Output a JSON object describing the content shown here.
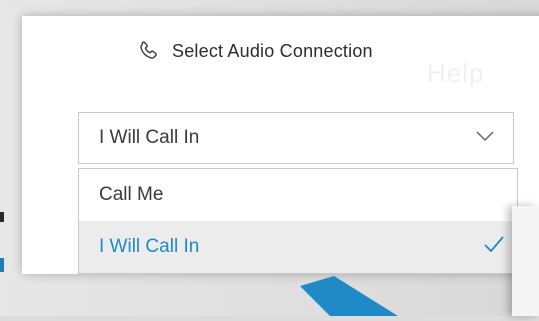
{
  "dialog": {
    "title": "Select Audio Connection",
    "faded_text": "Help"
  },
  "audio_select": {
    "selected_value": "I Will Call In",
    "options": [
      {
        "label": "Call Me",
        "selected": false
      },
      {
        "label": "I Will Call In",
        "selected": true
      }
    ]
  },
  "icons": {
    "phone": "phone-icon",
    "dropdown": "chevron-down-icon",
    "checkmark": "checkmark-icon"
  },
  "colors": {
    "accent": "#1f8ac6",
    "highlight_row": "#ececec",
    "text": "#3a3a3a",
    "border": "#c9c9c9"
  }
}
